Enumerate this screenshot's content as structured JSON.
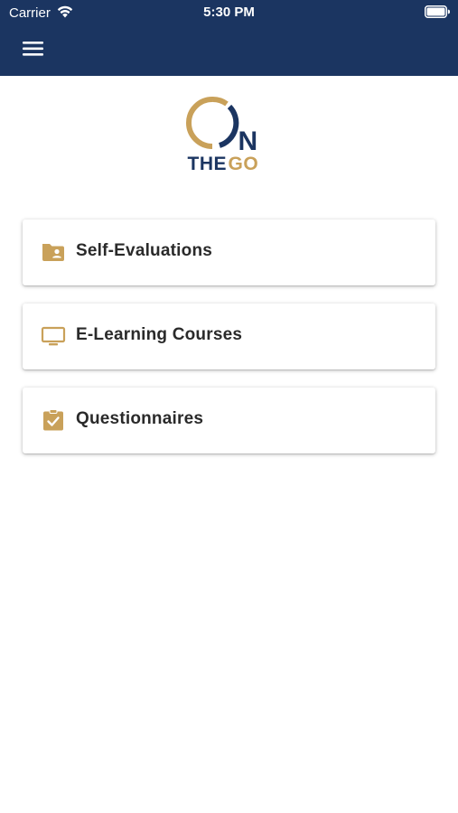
{
  "status_bar": {
    "carrier": "Carrier",
    "time": "5:30 PM"
  },
  "app": {
    "logo_the": "THE",
    "logo_go": "GO",
    "logo_n": "N"
  },
  "menu": [
    {
      "label": "Self-Evaluations",
      "icon": "folder-user-icon"
    },
    {
      "label": "E-Learning Courses",
      "icon": "monitor-icon"
    },
    {
      "label": "Questionnaires",
      "icon": "clipboard-check-icon"
    }
  ],
  "colors": {
    "header_bg": "#1b3561",
    "accent_gold": "#c9a15a",
    "brand_navy": "#1b3561"
  }
}
